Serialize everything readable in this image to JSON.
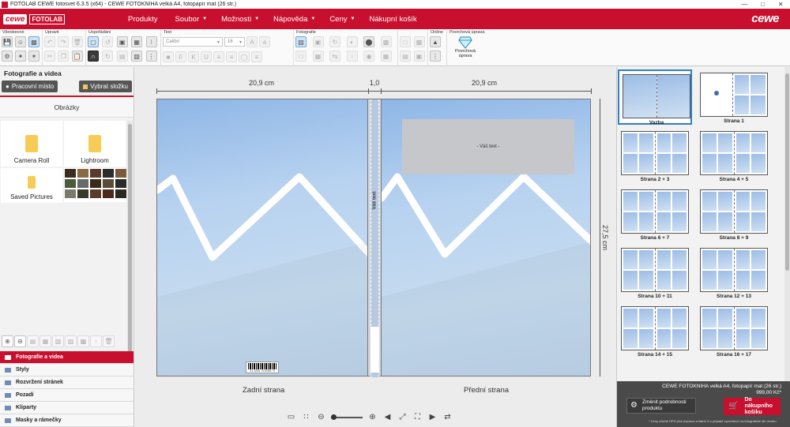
{
  "window": {
    "title": "FOTOLAB CEWE fotosvet 6.3.5 (x64) - CEWE FOTOKNIHA velká A4, fotopapír mat (26 str.)"
  },
  "brand": {
    "logo_left": "cewe",
    "fotolab": "FOTOLAB",
    "logo_right": "cewe"
  },
  "menu": [
    {
      "label": "Produkty",
      "caret": ""
    },
    {
      "label": "Soubor",
      "caret": "▼"
    },
    {
      "label": "Možnosti",
      "caret": "▼"
    },
    {
      "label": "Nápověda",
      "caret": "▼"
    },
    {
      "label": "Ceny",
      "caret": "▼"
    },
    {
      "label": "Nákupní košík",
      "caret": ""
    }
  ],
  "ribbon": {
    "groups": [
      "Všeobecné",
      "Upravit",
      "Uspořádání",
      "Text",
      "Fotografie",
      "Online",
      "Povrchová úprava"
    ],
    "font_name": "Calibri",
    "font_size": "16",
    "finish_label": "Povrchová úprava"
  },
  "left_panel": {
    "title": "Fotografie a videa",
    "workspace_button": "Pracovní místo",
    "select_folder_button": "Vybrat složku",
    "tab": "Obrázky",
    "folders": [
      "Camera Roll",
      "Lightroom",
      "Saved Pictures"
    ],
    "accordion": [
      {
        "label": "Fotografie a videa",
        "active": true
      },
      {
        "label": "Styly",
        "active": false
      },
      {
        "label": "Rozvržení stránek",
        "active": false
      },
      {
        "label": "Pozadí",
        "active": false
      },
      {
        "label": "Kliparty",
        "active": false
      },
      {
        "label": "Masky a rámečky",
        "active": false
      }
    ]
  },
  "canvas": {
    "dim_back": "20,9 cm",
    "dim_spine": "1,0",
    "dim_front": "20,9 cm",
    "dim_height": "27,5 cm",
    "spine_text": "Váš text",
    "front_text_placeholder": "- Váš text -",
    "back_label": "Zadní strana",
    "front_label": "Přední strana",
    "barcode_text": "01 1234 / 5 6789 / 3"
  },
  "pages": [
    {
      "label": "Vazba",
      "kind": "cover",
      "selected": true
    },
    {
      "label": "Strana 1",
      "kind": "first",
      "selected": false
    },
    {
      "label": "Strana 2 + 3",
      "kind": "spread",
      "selected": false
    },
    {
      "label": "Strana 4 + 5",
      "kind": "spread",
      "selected": false
    },
    {
      "label": "Strana 6 + 7",
      "kind": "spread",
      "selected": false
    },
    {
      "label": "Strana 8 + 9",
      "kind": "spread",
      "selected": false
    },
    {
      "label": "Strana 10 + 11",
      "kind": "spread",
      "selected": false
    },
    {
      "label": "Strana 12 + 13",
      "kind": "spread",
      "selected": false
    },
    {
      "label": "Strana 14 + 15",
      "kind": "spread",
      "selected": false
    },
    {
      "label": "Strana 16 + 17",
      "kind": "spread",
      "selected": false
    }
  ],
  "order": {
    "product": "CEWE FOTOKNIHA velká A4, fotopapír mat (26 str.)",
    "price": "999,00 Kč*",
    "change_button": "Změnit podrobnosti produktu",
    "cart_button": "Do nákupního košíku",
    "footnote": "* Ceny včetně DPH plus doprava a balné či v případě vyzvednutí na fotografické dle ceníku."
  },
  "colors": {
    "accent": "#c8102e",
    "selection": "#2e7fc6"
  }
}
